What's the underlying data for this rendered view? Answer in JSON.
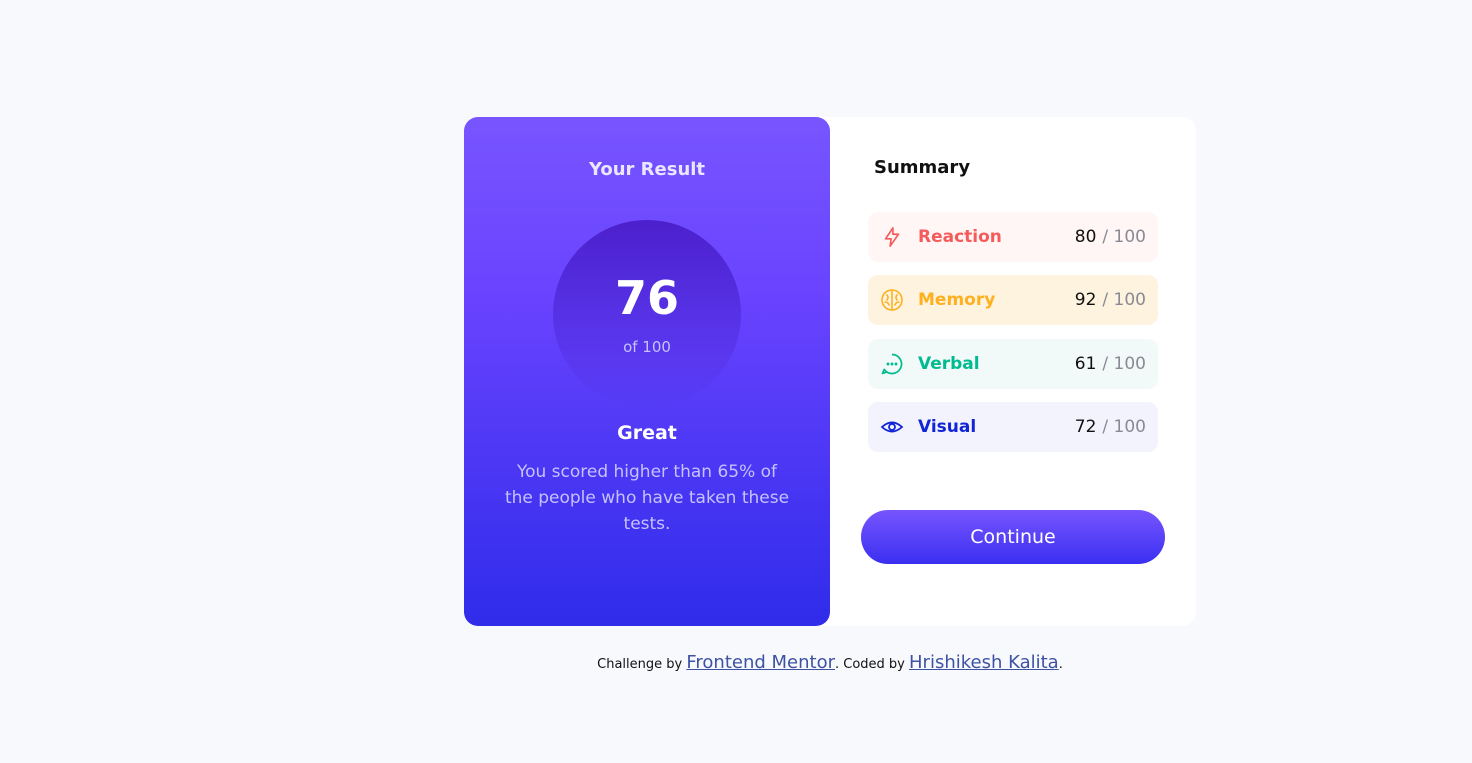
{
  "result": {
    "title": "Your Result",
    "score": "76",
    "out_of": "of 100",
    "verdict": "Great",
    "description": "You scored higher than 65% of the people who have taken these tests."
  },
  "summary": {
    "title": "Summary",
    "items": [
      {
        "label": "Reaction",
        "score": "80",
        "max": "/ 100",
        "icon": "lightning-icon",
        "color": "#f55b5b",
        "bg": "#fff6f5"
      },
      {
        "label": "Memory",
        "score": "92",
        "max": "/ 100",
        "icon": "brain-icon",
        "color": "#ffb01f",
        "bg": "#fdf3df"
      },
      {
        "label": "Verbal",
        "score": "61",
        "max": "/ 100",
        "icon": "chat-bubble-icon",
        "color": "#00bb8f",
        "bg": "#f1faf8"
      },
      {
        "label": "Visual",
        "score": "72",
        "max": "/ 100",
        "icon": "eye-icon",
        "color": "#1125d6",
        "bg": "#f2f3fd"
      }
    ],
    "button_label": "Continue"
  },
  "footer": {
    "prefix": "Challenge by",
    "link1": "Frontend Mentor",
    "middle": ". Coded by",
    "link2": "Hrishikesh Kalita",
    "suffix": "."
  }
}
